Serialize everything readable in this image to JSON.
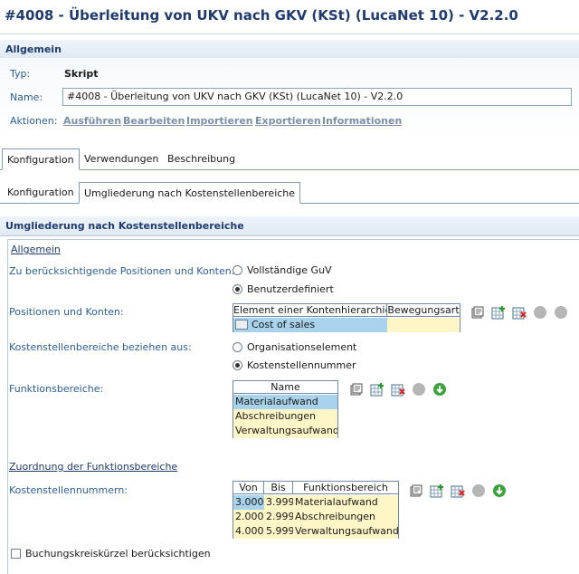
{
  "title": "#4008 - Überleitung von UKV nach GKV (KSt) (LucaNet 10) - V2.2.0",
  "general": {
    "header": "Allgemein",
    "type_label": "Typ:",
    "type_value": "Skript",
    "name_label": "Name:",
    "name_value": "#4008 - Überleitung von UKV nach GKV (KSt) (LucaNet 10) - V2.2.0",
    "actions_label": "Aktionen:",
    "actions": [
      "Ausführen",
      "Bearbeiten",
      "Importieren",
      "Exportieren",
      "Informationen"
    ]
  },
  "tabs_main": [
    "Konfiguration",
    "Verwendungen",
    "Beschreibung"
  ],
  "tabs_sub": [
    "Konfiguration",
    "Umgliederung nach Kostenstellenbereiche"
  ],
  "section_title": "Umgliederung nach Kostenstellenbereiche",
  "group1": {
    "title": "Allgemein",
    "positions_label": "Zu berücksichtigende Positionen und Konten:",
    "positions_options": [
      "Vollständige GuV",
      "Benutzerdefiniert"
    ],
    "positions_selected": "Benutzerdefiniert",
    "pk_label": "Positionen und Konten:",
    "pk_columns": [
      "Element einer Kontenhierarchie",
      "Bewegungsart"
    ],
    "pk_rows": [
      {
        "element": "Cost of sales",
        "movement": ""
      }
    ],
    "ksb_label": "Kostenstellenbereiche beziehen aus:",
    "ksb_options": [
      "Organisationselement",
      "Kostenstellennummer"
    ],
    "ksb_selected": "Kostenstellennummer",
    "fb_label": "Funktionsbereiche:",
    "fb_column": "Name",
    "fb_rows": [
      "Materialaufwand",
      "Abschreibungen",
      "Verwaltungsaufwand"
    ]
  },
  "group2": {
    "title": "Zuordnung der Funktionsbereiche",
    "ksn_label": "Kostenstellennummern:",
    "columns": [
      "Von",
      "Bis",
      "Funktionsbereich"
    ],
    "rows": [
      {
        "von": "3.000",
        "bis": "3.999",
        "fb": "Materialaufwand"
      },
      {
        "von": "2.000",
        "bis": "2.999",
        "fb": "Abschreibungen"
      },
      {
        "von": "4.000",
        "bis": "5.999",
        "fb": "Verwaltungsaufwand"
      }
    ]
  },
  "checkbox_label": "Buchungskreiskürzel berücksichtigen",
  "checkbox_checked": false,
  "colors": {
    "title": "#1f3b6f",
    "label": "#2a5e9a",
    "selected_row": "#a9d3ec",
    "row_bg": "#fff6c8"
  }
}
